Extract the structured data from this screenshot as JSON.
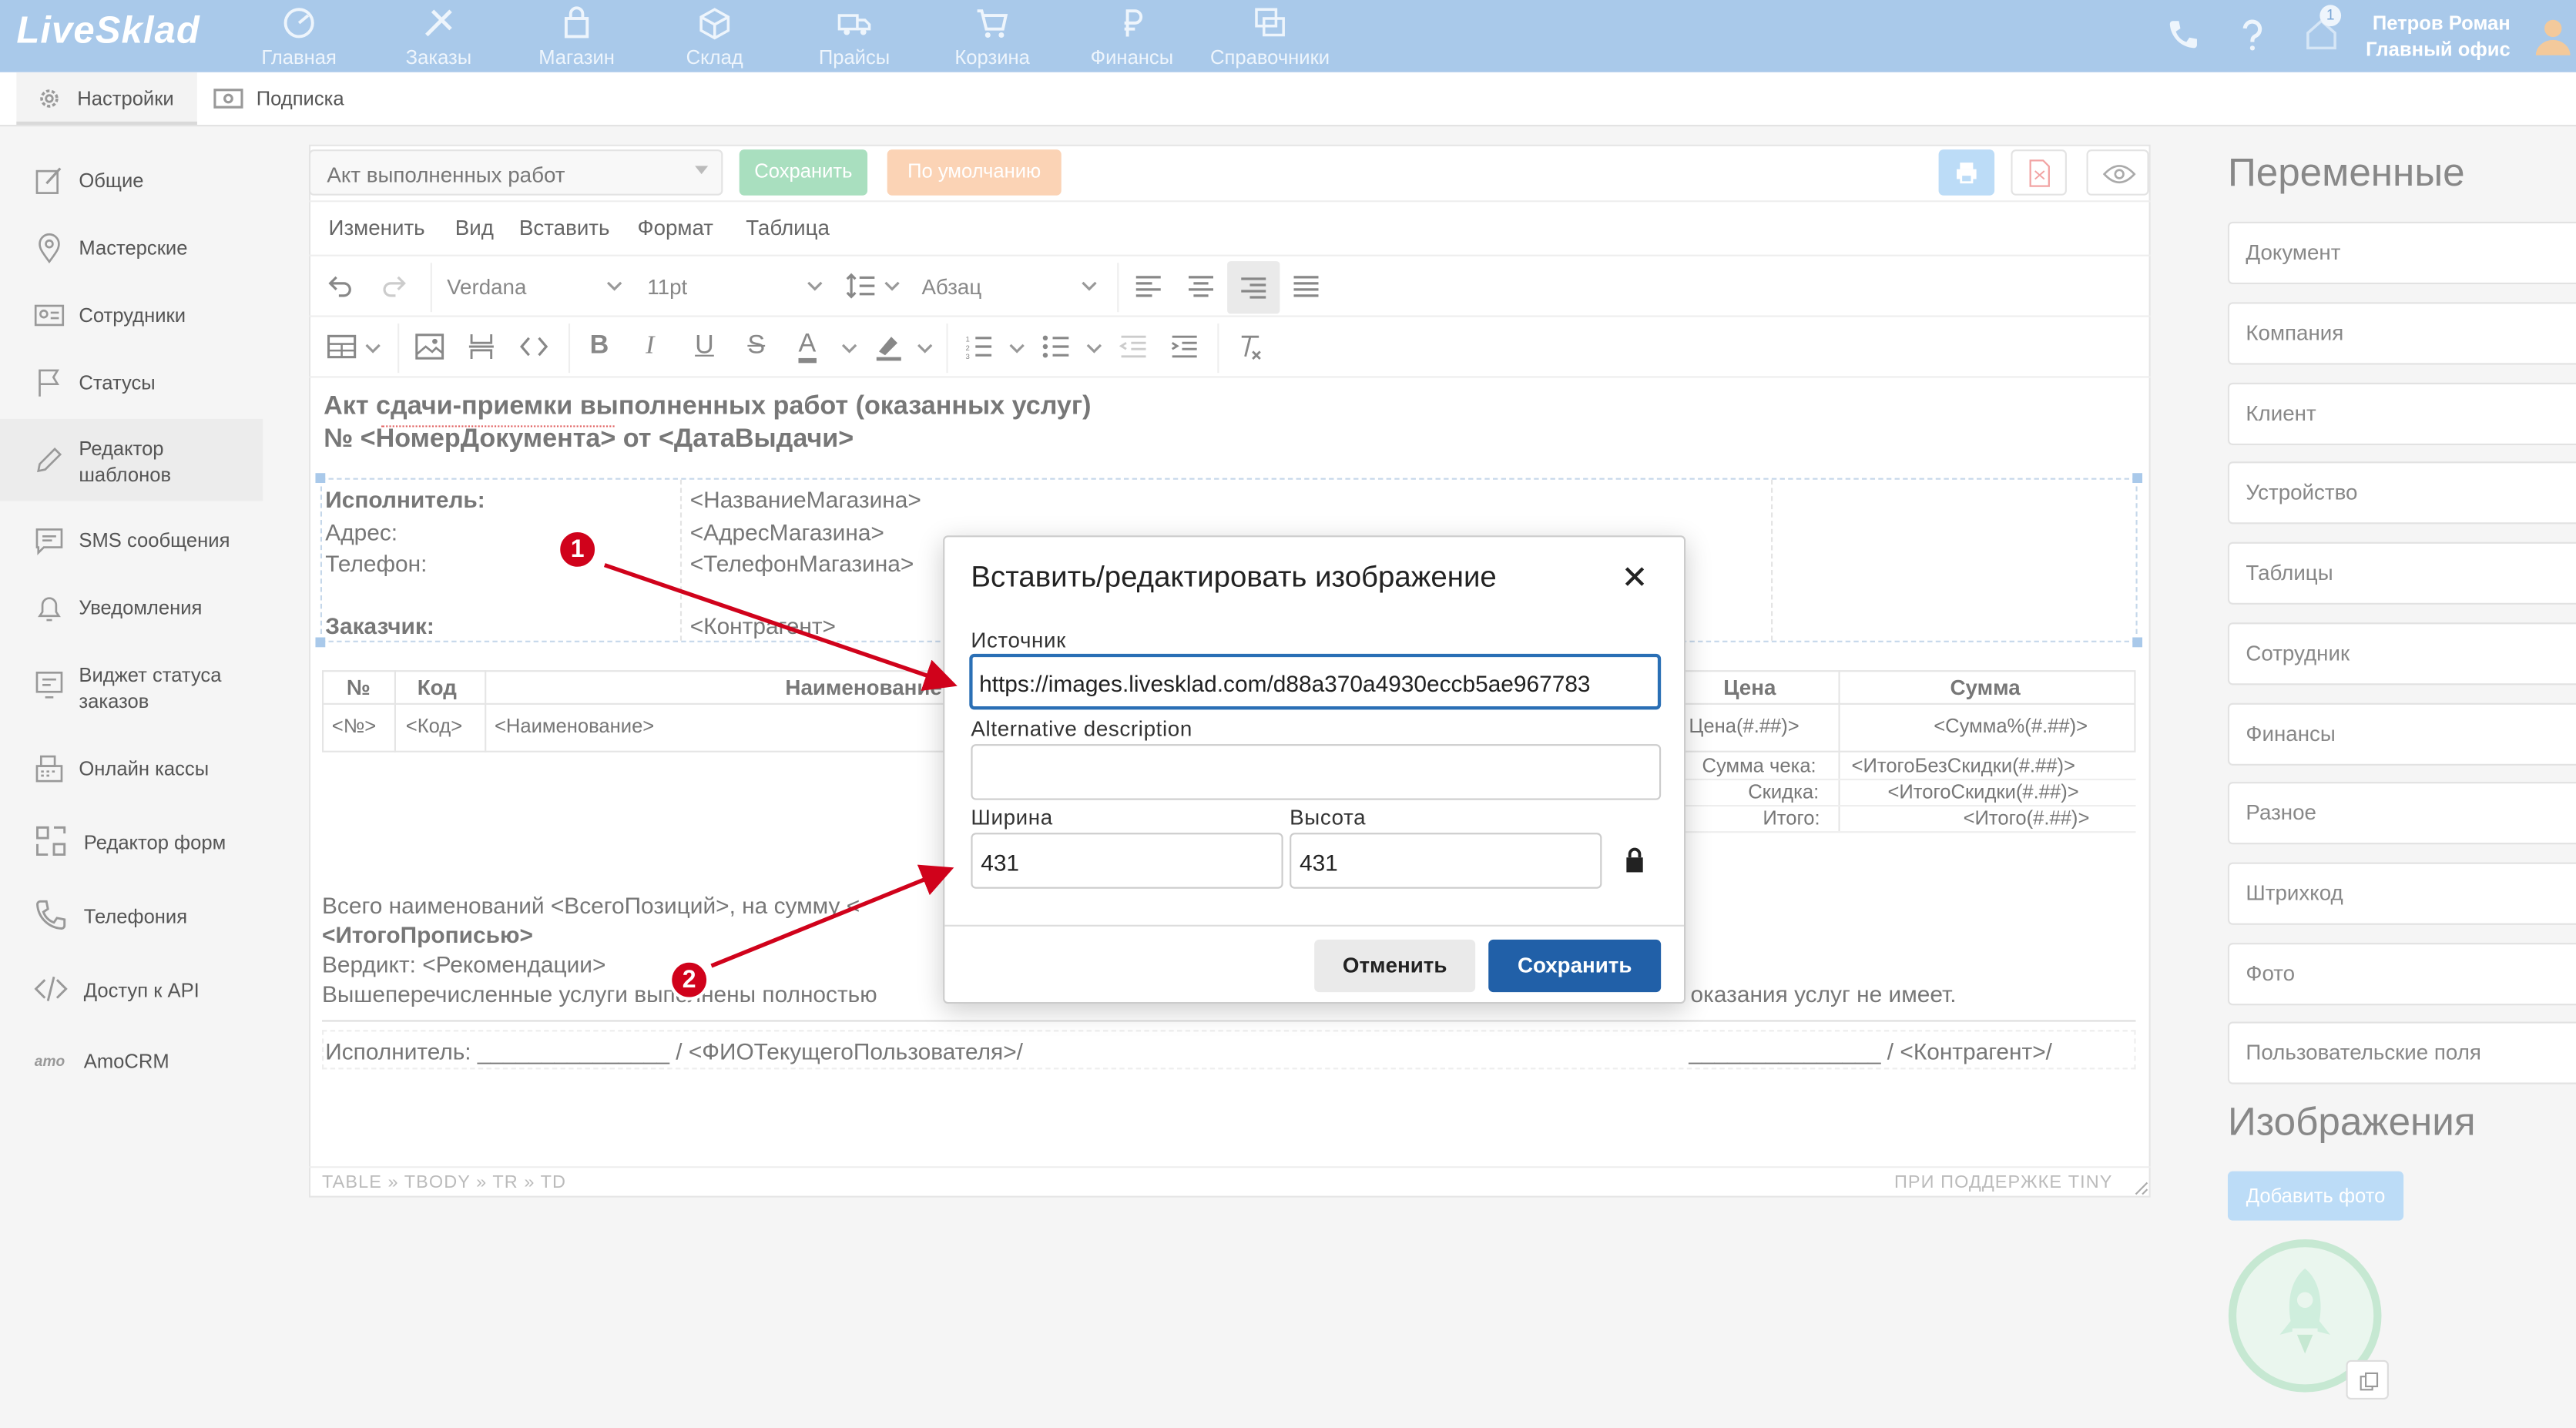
{
  "app": {
    "logo": "LiveSklad"
  },
  "nav": [
    "Главная",
    "Заказы",
    "Магазин",
    "Склад",
    "Прайсы",
    "Корзина",
    "Финансы",
    "Справочники"
  ],
  "header": {
    "user_name": "Петров Роман",
    "office": "Главный офис",
    "notif_count": "1"
  },
  "subtabs": [
    "Настройки",
    "Подписка"
  ],
  "sidebar": {
    "items": [
      "Общие",
      "Мастерские",
      "Сотрудники",
      "Статусы",
      "Редактор шаблонов",
      "SMS сообщения",
      "Уведомления",
      "Виджет статуса заказов",
      "Онлайн кассы",
      "Редактор форм",
      "Телефония",
      "Доступ к API",
      "AmoCRM"
    ]
  },
  "editor": {
    "template_select": "Акт выполненных работ",
    "save_label": "Сохранить",
    "default_label": "По умолчанию",
    "menu": [
      "Изменить",
      "Вид",
      "Вставить",
      "Формат",
      "Таблица"
    ],
    "font": "Verdana",
    "font_size": "11pt",
    "block": "Абзац",
    "status_path": "TABLE » TBODY » TR » TD",
    "powered": "ПРИ ПОДДЕРЖКЕ TINY"
  },
  "doc": {
    "title1": "Акт сдачи-приемки выполненных работ (оказанных услуг)",
    "title2": "№ <НомерДокумента> от <ДатаВыдачи>",
    "executor_label": "Исполнитель:",
    "executor_val": "<НазваниеМагазина>",
    "address_label": "Адрес:",
    "address_val": "<АдресМагазина>",
    "phone_label": "Телефон:",
    "phone_val": "<ТелефонМагазина>",
    "client_label": "Заказчик:",
    "client_val": "<Контрагент>",
    "col_no": "№",
    "col_code": "Код",
    "col_name": "Наименование",
    "col_price": "Цена",
    "col_sum": "Сумма",
    "row_no": "<№>",
    "row_code": "<Код>",
    "row_name": "<Наименование>",
    "row_price": "Цена(#.##)>",
    "row_sum": "<Сумма%(#.##)>",
    "check_label": "Сумма чека:",
    "check_val": "<ИтогоБезСкидки(#.##)>",
    "disc_label": "Скидка:",
    "disc_val": "<ИтогоСкидки(#.##)>",
    "total_label": "Итого:",
    "total_val": "<Итого(#.##)>",
    "line1": "Всего наименований <ВсегоПозиций>, на сумму <",
    "line2": "<ИтогоПрописью>",
    "line3": "Вердикт: <Рекомендации>",
    "line4a": "Вышеперечисленные услуги выполнены полностью",
    "line4b": "оказания услуг не имеет.",
    "sign_left": "Исполнитель: _______________ / <ФИОТекущегоПользователя>/",
    "sign_right": "_______________ / <Контрагент>/"
  },
  "right": {
    "vars_title": "Переменные",
    "vars": [
      "Документ",
      "Компания",
      "Клиент",
      "Устройство",
      "Таблицы",
      "Сотрудник",
      "Финансы",
      "Разное",
      "Штрихкод",
      "Фото",
      "Пользовательские поля"
    ],
    "images_title": "Изображения",
    "add_photo": "Добавить фото"
  },
  "dialog": {
    "title": "Вставить/редактировать изображение",
    "source_label": "Источник",
    "source_value": "https://images.livesklad.com/d88a370a4930eccb5ae967783",
    "alt_label": "Alternative description",
    "alt_value": "",
    "width_label": "Ширина",
    "width_value": "431",
    "height_label": "Высота",
    "height_value": "431",
    "cancel": "Отменить",
    "save": "Сохранить"
  },
  "annotations": [
    "1",
    "2"
  ],
  "colors": {
    "topbar": "#a9c9ea",
    "primary": "#2160a8",
    "arrow": "#d0021b",
    "green_btn": "#a9dfbf",
    "orange_btn": "#fbd3b5"
  }
}
